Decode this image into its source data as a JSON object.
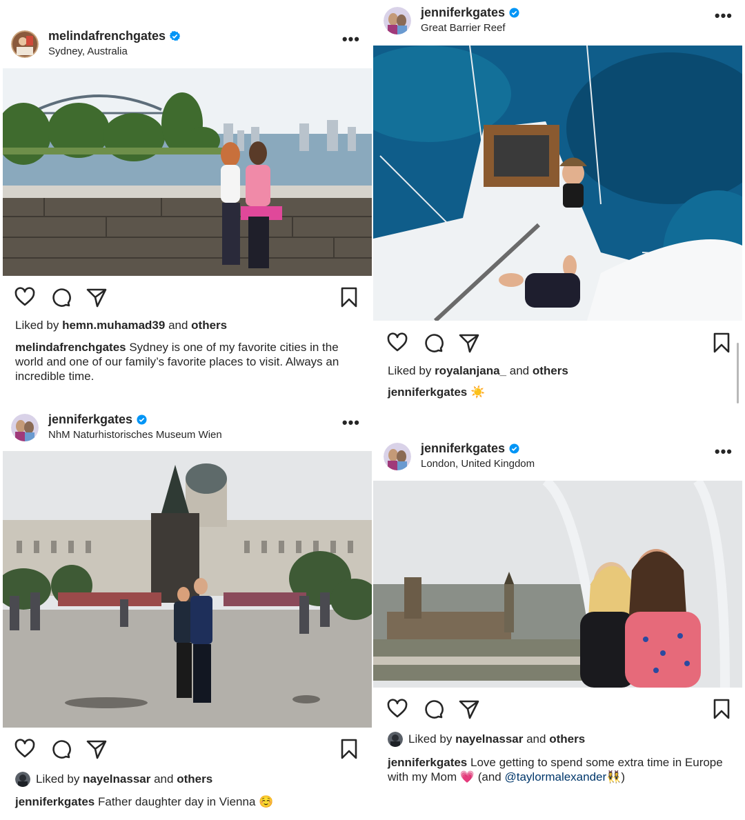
{
  "posts": [
    {
      "username": "melindafrenchgates",
      "location": "Sydney, Australia",
      "liked_by_prefix": "Liked by",
      "liked_by_user": "hemn.muhamad39",
      "liked_by_and": "and",
      "liked_by_others": "others",
      "caption_user": "melindafrenchgates",
      "caption_text": "Sydney is one of my favorite cities in the world and one of our family’s favorite places to visit. Always an incredible time."
    },
    {
      "username": "jenniferkgates",
      "location": "Great Barrier Reef",
      "liked_by_prefix": "Liked by",
      "liked_by_user": "royalanjana_",
      "liked_by_and": "and",
      "liked_by_others": "others",
      "caption_user": "jenniferkgates",
      "caption_text": "☀️"
    },
    {
      "username": "jenniferkgates",
      "location": "NhM Naturhistorisches Museum Wien",
      "liked_by_prefix": "Liked by",
      "liked_by_user": "nayelnassar",
      "liked_by_and": "and",
      "liked_by_others": "others",
      "caption_user": "jenniferkgates",
      "caption_text": "Father daughter day in Vienna ☺️"
    },
    {
      "username": "jenniferkgates",
      "location": "London, United Kingdom",
      "liked_by_prefix": "Liked by",
      "liked_by_user": "nayelnassar",
      "liked_by_and": "and",
      "liked_by_others": "others",
      "caption_user": "jenniferkgates",
      "caption_text": "Love getting to spend some extra time in Europe with my Mom 💗 (and",
      "caption_mention": "@taylormalexander",
      "caption_tail": "👯‍♀️)"
    }
  ],
  "icons": {
    "more": "more-options-icon",
    "like": "heart-icon",
    "comment": "comment-icon",
    "share": "share-icon",
    "save": "bookmark-icon",
    "verified": "verified-badge-icon"
  },
  "colors": {
    "verified_blue": "#0095f6",
    "text": "#262626",
    "mention": "#00376b"
  }
}
